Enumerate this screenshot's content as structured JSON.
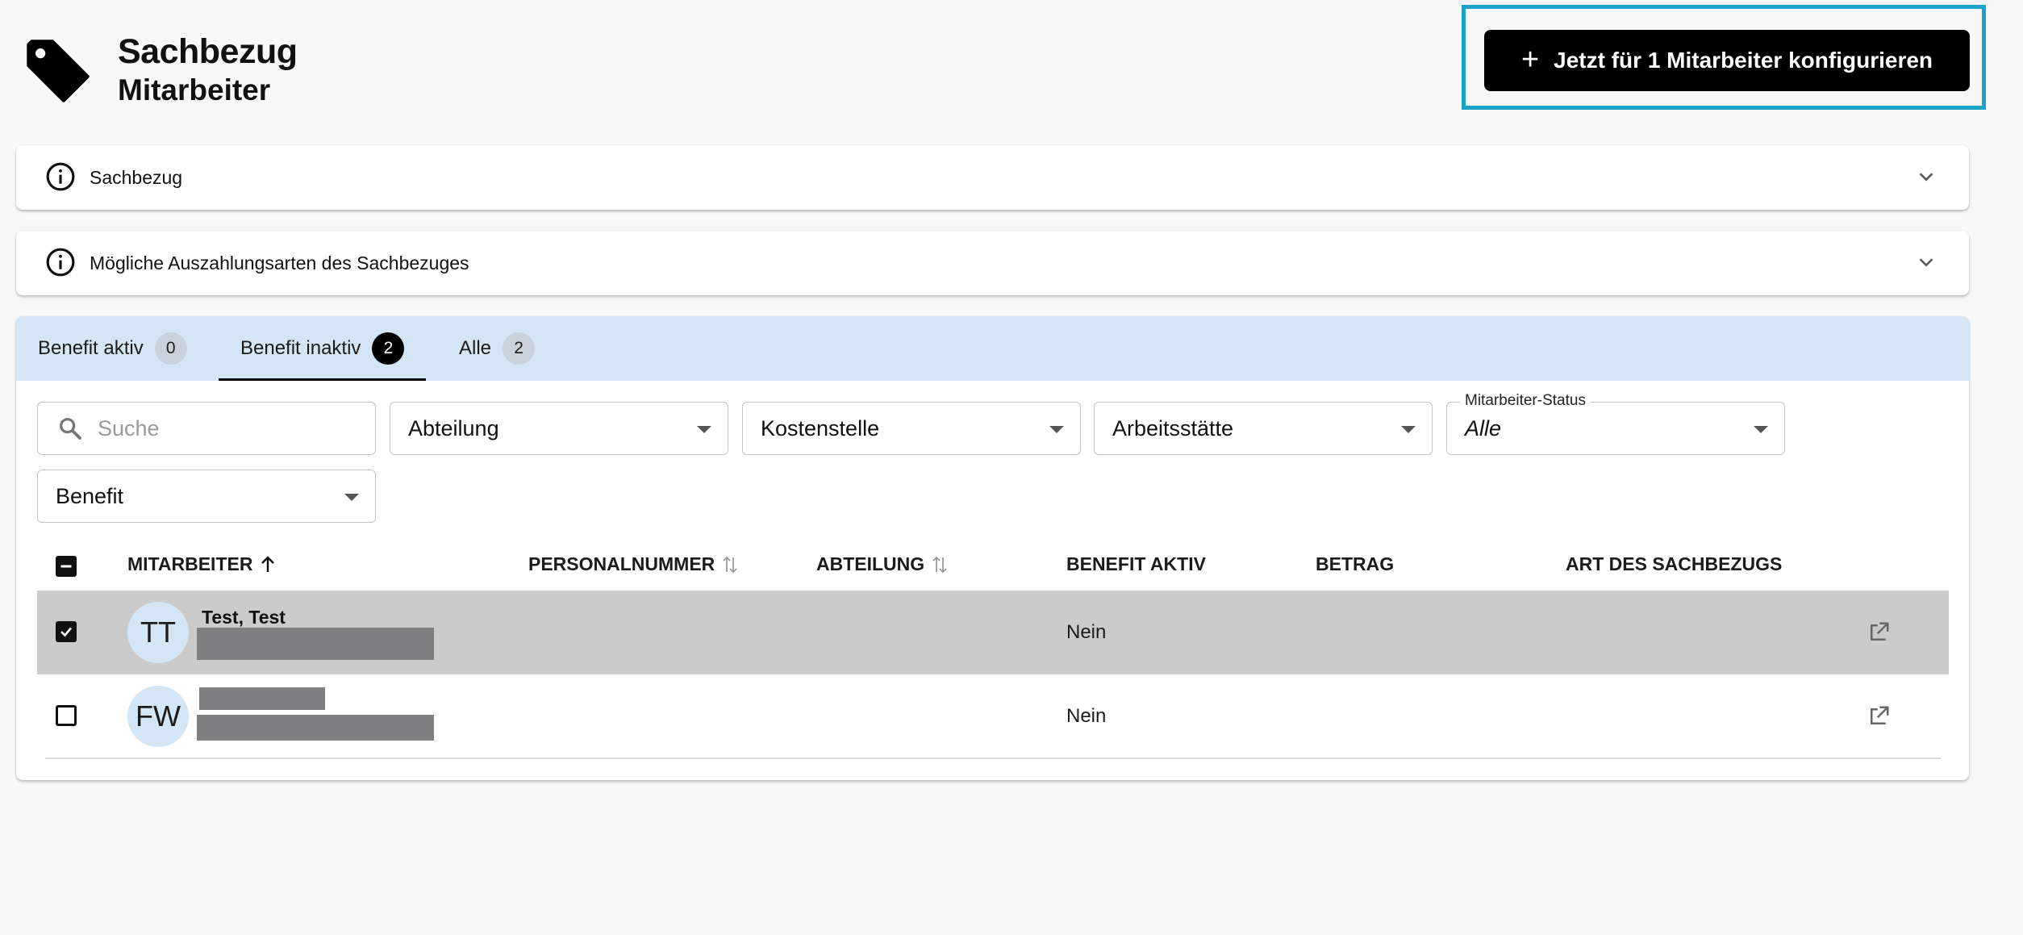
{
  "header": {
    "title": "Sachbezug",
    "subtitle": "Mitarbeiter",
    "icon": "tag-icon",
    "cta_plus": "+",
    "cta_label": "Jetzt für 1 Mitarbeiter konfigurieren"
  },
  "accordions": [
    {
      "label": "Sachbezug",
      "icon": "info-icon"
    },
    {
      "label": "Mögliche Auszahlungsarten des Sachbezuges",
      "icon": "info-icon"
    }
  ],
  "tabs": [
    {
      "label": "Benefit aktiv",
      "count": "0",
      "active": false
    },
    {
      "label": "Benefit inaktiv",
      "count": "2",
      "active": true
    },
    {
      "label": "Alle",
      "count": "2",
      "active": false
    }
  ],
  "filters": {
    "search_placeholder": "Suche",
    "abteilung": "Abteilung",
    "kostenstelle": "Kostenstelle",
    "arbeitsstaette": "Arbeitsstätte",
    "status_label": "Mitarbeiter-Status",
    "status_value": "Alle",
    "benefit": "Benefit"
  },
  "table": {
    "columns": [
      "MITARBEITER",
      "PERSONALNUMMER",
      "ABTEILUNG",
      "BENEFIT AKTIV",
      "BETRAG",
      "ART DES SACHBEZUGS"
    ],
    "rows": [
      {
        "initials": "TT",
        "name": "Test, Test",
        "benefit_aktiv": "Nein",
        "selected": true
      },
      {
        "initials": "FW",
        "name": "",
        "benefit_aktiv": "Nein",
        "selected": false
      }
    ]
  },
  "colors": {
    "accent_frame": "#1aa3c9",
    "tabbar_bg": "#d4e6f4",
    "selected_row": "#cbcbcb",
    "avatar_bg": "#d3e6f6"
  }
}
